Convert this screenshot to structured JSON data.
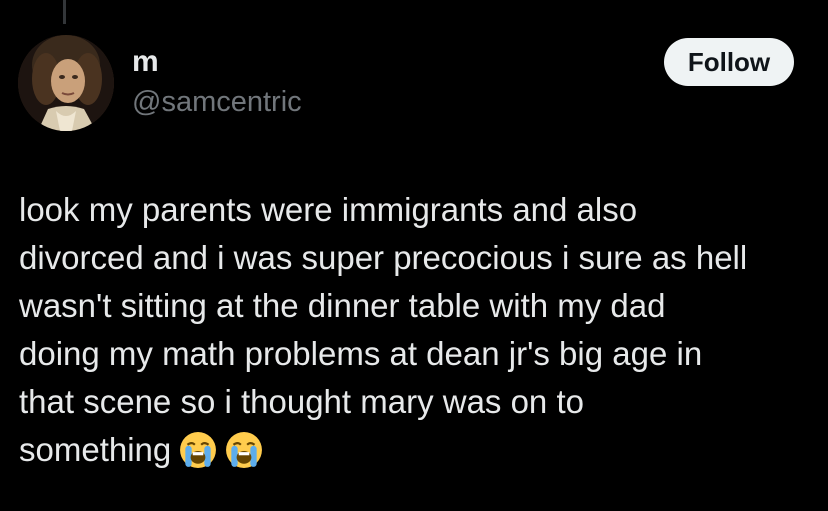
{
  "thread": {
    "connector": true
  },
  "author": {
    "display_name": "m",
    "handle": "@samcentric",
    "avatar_icon": "profile-photo"
  },
  "follow": {
    "label": "Follow"
  },
  "tweet": {
    "text": "look my parents were immigrants and also\ndivorced and i was super precocious i sure as hell\nwasn't sitting at the dinner table with my dad\ndoing my math problems at dean jr's big age in\nthat scene so i thought mary was on to\nsomething",
    "emojis": [
      "loudly-crying-face-emoji",
      "loudly-crying-face-emoji"
    ]
  },
  "colors": {
    "background": "#000000",
    "text_primary": "#e7e9ea",
    "text_secondary": "#71767b",
    "follow_bg": "#eff3f4",
    "follow_text": "#0f1419"
  }
}
